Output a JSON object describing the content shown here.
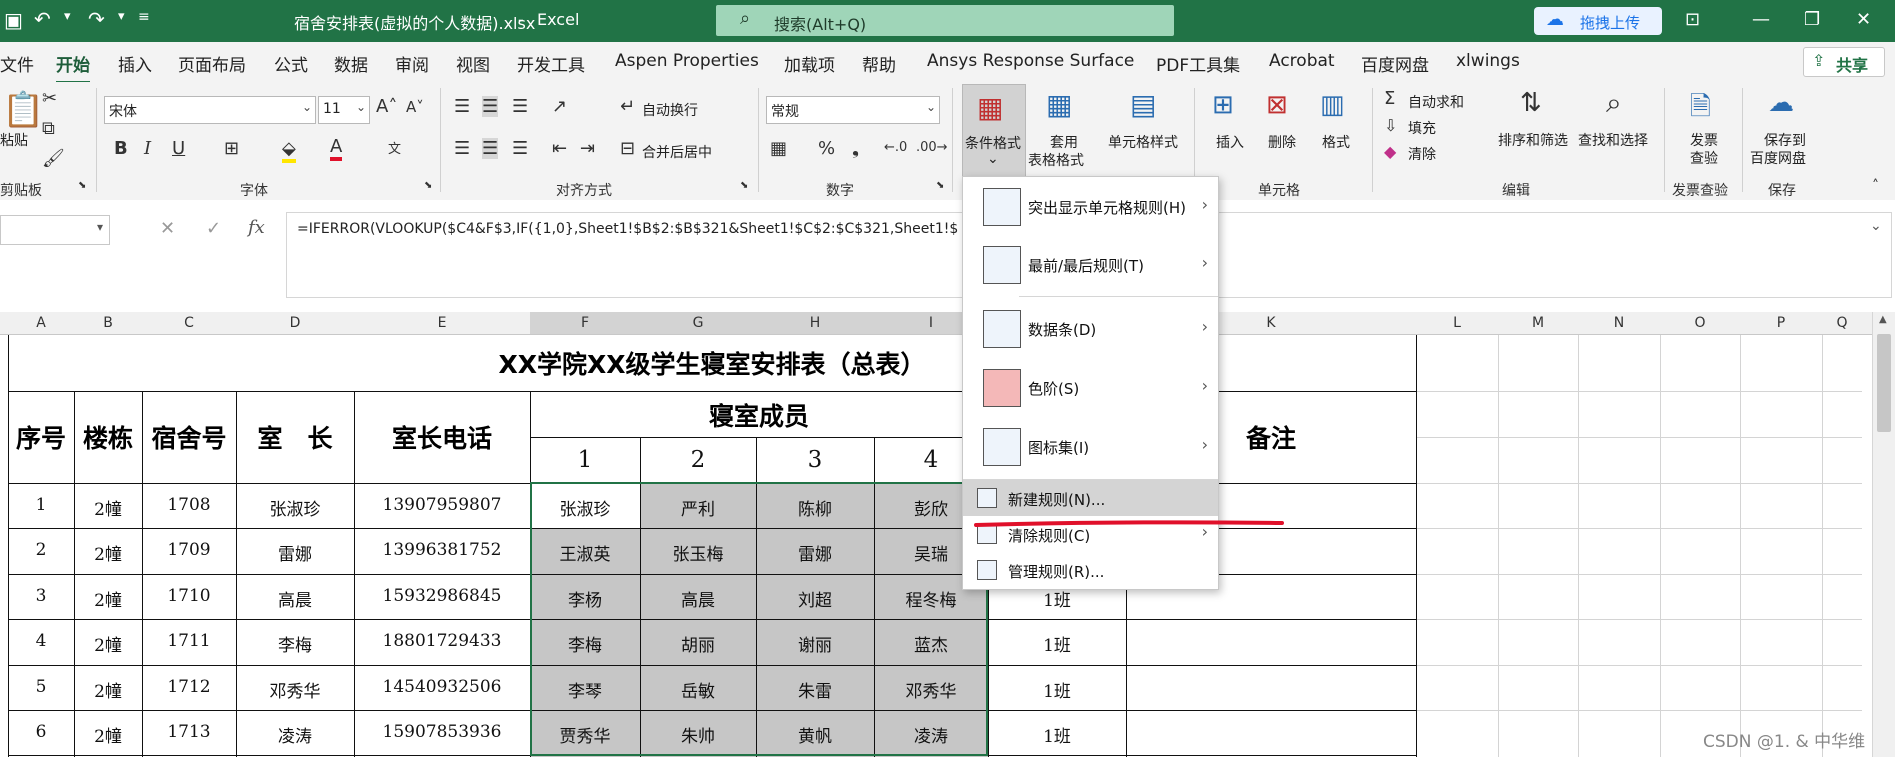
{
  "titlebar": {
    "filename": "宿舍安排表(虚拟的个人数据).xlsx",
    "separator": "-",
    "app": "Excel",
    "search_placeholder": "搜索(Alt+Q)",
    "upload_label": "拖拽上传"
  },
  "menu": {
    "tabs": [
      "文件",
      "开始",
      "插入",
      "页面布局",
      "公式",
      "数据",
      "审阅",
      "视图",
      "开发工具",
      "Aspen Properties",
      "加载项",
      "帮助",
      "Ansys Response Surface",
      "PDF工具集",
      "Acrobat",
      "百度网盘",
      "xlwings"
    ],
    "share": "共享"
  },
  "ribbon": {
    "paste": "粘贴",
    "clipboard": "剪贴板",
    "font_name": "宋体",
    "font_size": "11",
    "font_group": "字体",
    "wrap_text": "自动换行",
    "merge_center": "合并后居中",
    "align_group": "对齐方式",
    "number_format": "常规",
    "number_group": "数字",
    "cond_format": "条件格式",
    "table_format_1": "套用",
    "table_format_2": "表格格式",
    "cell_style": "单元格样式",
    "insert": "插入",
    "delete": "删除",
    "format": "格式",
    "cells_group": "单元格",
    "autosum": "自动求和",
    "fill": "填充",
    "clear": "清除",
    "sort_filter": "排序和筛选",
    "find_select": "查找和选择",
    "edit_group": "编辑",
    "invoice_1": "发票",
    "invoice_2": "查验",
    "invoice_group": "发票查验",
    "save_baidu_1": "保存到",
    "save_baidu_2": "百度网盘",
    "save_group": "保存",
    "bold": "B",
    "italic": "I",
    "underline": "U",
    "percent": "%",
    "font_a": "A"
  },
  "formula": {
    "fx": "fx",
    "text": "=IFERROR(VLOOKUP($C4&F$3,IF({1,0},Sheet1!$B$2:$B$321&Sheet1!$C$2:$C$321,Sheet1!$"
  },
  "columns": [
    "A",
    "B",
    "C",
    "D",
    "E",
    "F",
    "G",
    "H",
    "I",
    "K",
    "L",
    "M",
    "N",
    "O",
    "P",
    "Q"
  ],
  "sheet": {
    "title": "XX学院XX级学生寝室安排表（总表）",
    "headers": {
      "seq": "序号",
      "building": "楼栋",
      "room": "宿舍号",
      "leader": "室　长",
      "phone": "室长电话",
      "members": "寝室成员",
      "m1": "1",
      "m2": "2",
      "m3": "3",
      "m4": "4",
      "remark": "备注"
    },
    "rows": [
      {
        "seq": "1",
        "building": "2幢",
        "room": "1708",
        "leader": "张淑珍",
        "phone": "13907959807",
        "m1": "张淑珍",
        "m2": "严利",
        "m3": "陈柳",
        "m4": "彭欣",
        "cls": ""
      },
      {
        "seq": "2",
        "building": "2幢",
        "room": "1709",
        "leader": "雷娜",
        "phone": "13996381752",
        "m1": "王淑英",
        "m2": "张玉梅",
        "m3": "雷娜",
        "m4": "吴瑞",
        "cls": ""
      },
      {
        "seq": "3",
        "building": "2幢",
        "room": "1710",
        "leader": "高晨",
        "phone": "15932986845",
        "m1": "李杨",
        "m2": "高晨",
        "m3": "刘超",
        "m4": "程冬梅",
        "cls": "1班"
      },
      {
        "seq": "4",
        "building": "2幢",
        "room": "1711",
        "leader": "李梅",
        "phone": "18801729433",
        "m1": "李梅",
        "m2": "胡丽",
        "m3": "谢丽",
        "m4": "蓝杰",
        "cls": "1班"
      },
      {
        "seq": "5",
        "building": "2幢",
        "room": "1712",
        "leader": "邓秀华",
        "phone": "14540932506",
        "m1": "李琴",
        "m2": "岳敏",
        "m3": "朱雷",
        "m4": "邓秀华",
        "cls": "1班"
      },
      {
        "seq": "6",
        "building": "2幢",
        "room": "1713",
        "leader": "凌涛",
        "phone": "15907853936",
        "m1": "贾秀华",
        "m2": "朱帅",
        "m3": "黄帆",
        "m4": "凌涛",
        "cls": "1班"
      }
    ]
  },
  "dropdown": {
    "items": [
      {
        "label": "突出显示单元格规则(H)",
        "submenu": true
      },
      {
        "label": "最前/最后规则(T)",
        "submenu": true
      },
      {
        "label": "数据条(D)",
        "submenu": true
      },
      {
        "label": "色阶(S)",
        "submenu": true
      },
      {
        "label": "图标集(I)",
        "submenu": true
      },
      {
        "label": "新建规则(N)...",
        "submenu": false
      },
      {
        "label": "清除规则(C)",
        "submenu": true
      },
      {
        "label": "管理规则(R)...",
        "submenu": false
      }
    ]
  },
  "watermark": "CSDN @1. & 中华维",
  "colors": {
    "excel_green": "#217346",
    "highlight_red": "#e0102a",
    "member_grey": "#c6c6c6"
  }
}
